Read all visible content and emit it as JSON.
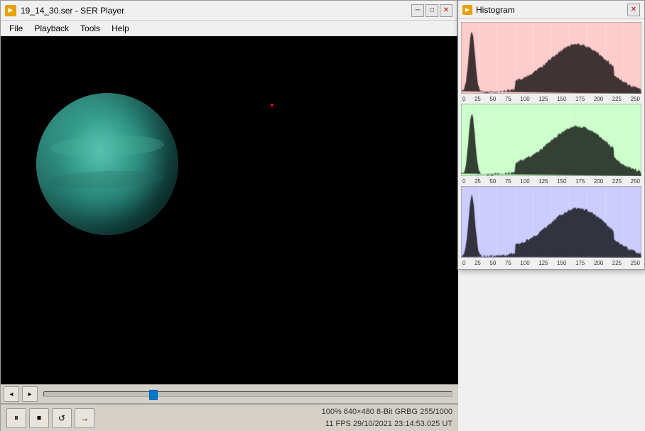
{
  "main_window": {
    "title": "19_14_30.ser - SER Player",
    "icon_label": "▶",
    "min_btn": "─",
    "max_btn": "□",
    "close_btn": "✕"
  },
  "menu": {
    "items": [
      "File",
      "Playback",
      "Tools",
      "Help"
    ]
  },
  "scrubber": {
    "prev_btn": "◂",
    "next_btn": "▸"
  },
  "controls": {
    "pause_btn": "⏸",
    "stop_btn": "⏹",
    "repeat_btn": "↺",
    "forward_btn": "→"
  },
  "status": {
    "line1": "100%  640×480  8-Bit  GRBG  255/1000",
    "line2": "11 FPS  29/10/2021  23:14:53.025 UT"
  },
  "histogram_window": {
    "title": "Histogram",
    "icon_label": "▶",
    "close_btn": "✕"
  },
  "histogram": {
    "axis_labels": [
      "0",
      "25",
      "50",
      "75",
      "100",
      "125",
      "150",
      "175",
      "200",
      "225",
      "250"
    ],
    "channels": [
      {
        "name": "red",
        "color": "#ffcccc",
        "peak_color": "#cc3333"
      },
      {
        "name": "green",
        "color": "#ccffcc",
        "peak_color": "#33aa33"
      },
      {
        "name": "blue",
        "color": "#ccccff",
        "peak_color": "#3333cc"
      }
    ]
  }
}
